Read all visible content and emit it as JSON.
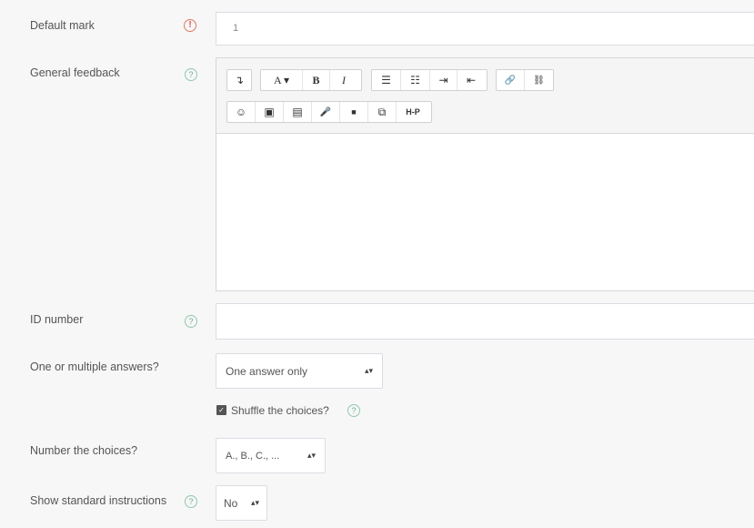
{
  "fields": {
    "default_mark": {
      "label": "Default mark",
      "value": "1"
    },
    "general_feedback": {
      "label": "General feedback"
    },
    "id_number": {
      "label": "ID number",
      "value": ""
    },
    "answers": {
      "label": "One or multiple answers?",
      "selected": "One answer only"
    },
    "shuffle": {
      "label": "Shuffle the choices?",
      "checked": true
    },
    "numbering": {
      "label": "Number the choices?",
      "selected": "A., B., C., ..."
    },
    "instructions": {
      "label": "Show standard instructions",
      "selected": "No"
    }
  },
  "toolbar": {
    "row1": {
      "toggle": "↴",
      "font": "A ▾",
      "bold": "B",
      "italic": "I",
      "ul": "☰",
      "ol": "☷",
      "indent": "⇥",
      "outdent": "⇤",
      "link": "🔗",
      "unlink": "⛓"
    },
    "row2": {
      "emoji": "☺",
      "image": "▣",
      "media": "▤",
      "record_audio": "🎤",
      "record_video": "■",
      "manage_files": "⧉",
      "h5p": "H-P"
    }
  },
  "icons": {
    "help": "?",
    "required": "!",
    "checkbox": "✓"
  },
  "colors": {
    "required": "#d9534f",
    "help": "#6fb08a"
  }
}
